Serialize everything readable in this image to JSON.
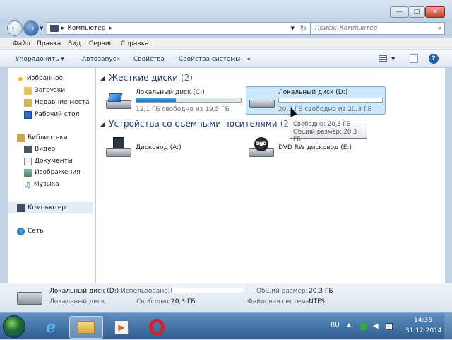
{
  "window": {
    "minimize_glyph": "—",
    "maximize_glyph": "□",
    "close_glyph": "✕"
  },
  "nav": {
    "back_glyph": "←",
    "forward_glyph": "→",
    "breadcrumb_sep": "▸",
    "breadcrumb": "Компьютер",
    "refresh_glyph": "↻",
    "search_placeholder": "Поиск: Компьютер"
  },
  "menu": [
    "Файл",
    "Правка",
    "Вид",
    "Сервис",
    "Справка"
  ],
  "toolbar": {
    "organize": "Упорядочить ▾",
    "autoplay": "Автозапуск",
    "properties": "Свойства",
    "system_properties": "Свойства системы",
    "more": "»"
  },
  "sidebar": {
    "favorites": "Избранное",
    "downloads": "Загрузки",
    "recent": "Недавние места",
    "desktop": "Рабочий стол",
    "libraries": "Библиотеки",
    "video": "Видео",
    "documents": "Документы",
    "images": "Изображения",
    "music": "Музыка",
    "computer": "Компьютер",
    "network": "Сеть"
  },
  "groups": {
    "hdd": {
      "title": "Жесткие диски",
      "count": "(2)"
    },
    "removable": {
      "title": "Устройства со съемными носителями",
      "count": "(2)"
    }
  },
  "drives": {
    "c": {
      "name": "Локальный диск (C:)",
      "space": "12,1 ГБ свободно из 19,5 ГБ",
      "used_fraction": 0.38
    },
    "d": {
      "name": "Локальный диск (D:)",
      "space": "20,3 ГБ свободно из 20,3 ГБ",
      "used_fraction": 0.0
    },
    "a": {
      "name": "Дисковод (A:)"
    },
    "e": {
      "name": "DVD RW дисковод (E:)",
      "badge": "DVD"
    }
  },
  "tooltip": {
    "free": "Свободно: 20,3 ГБ",
    "total": "Общий размер: 20,3 ГБ"
  },
  "details": {
    "name": "Локальный диск (D:)",
    "type": "Локальный диск",
    "used_label": "Использовано:",
    "used_fraction": 0.0,
    "free_label": "Свободно:",
    "free_value": "20,3 ГБ",
    "total_label": "Общий размер:",
    "total_value": "20,3 ГБ",
    "fs_label": "Файловая система:",
    "fs_value": "NTFS"
  },
  "taskbar": {
    "lang": "RU",
    "time": "14:36",
    "date": "31.12.2014"
  },
  "colors": {
    "accent": "#1e3287",
    "selection": "#cce8ff",
    "bar_fill": "#2a8fd6"
  }
}
